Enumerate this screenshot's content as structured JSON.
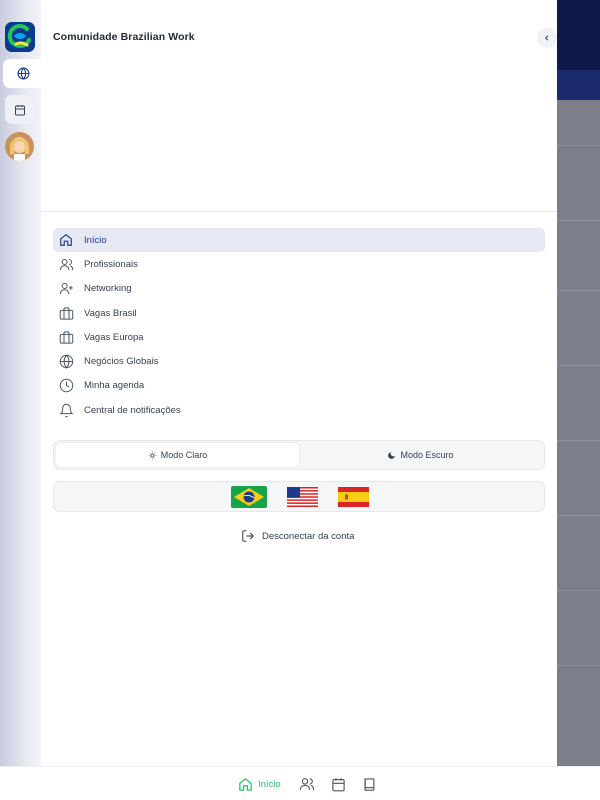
{
  "app": {
    "title": "Comunidade Brazilian Work"
  },
  "rail": {
    "items": [
      {
        "icon": "globe-icon",
        "active": true
      },
      {
        "icon": "calendar-icon",
        "active": false
      }
    ]
  },
  "nav": {
    "items": [
      {
        "label": "Início",
        "icon": "home-icon",
        "active": true
      },
      {
        "label": "Profissionais",
        "icon": "users-icon"
      },
      {
        "label": "Networking",
        "icon": "user-plus-icon"
      },
      {
        "label": "Vagas Brasil",
        "icon": "briefcase-icon"
      },
      {
        "label": "Vagas Europa",
        "icon": "briefcase-icon"
      },
      {
        "label": "Negócios Globais",
        "icon": "globe-icon"
      },
      {
        "label": "Minha agenda",
        "icon": "clock-icon"
      },
      {
        "label": "Central de notificações",
        "icon": "bell-icon"
      }
    ]
  },
  "theme": {
    "light_label": "Modo Claro",
    "dark_label": "Modo Escuro",
    "selected": "light"
  },
  "languages": [
    "flag-brazil-icon",
    "flag-usa-icon",
    "flag-spain-icon"
  ],
  "logout": {
    "label": "Desconectar da conta"
  },
  "bottom_nav": {
    "home_label": "Início"
  },
  "colors": {
    "accent": "#1e3a8a",
    "active_bg": "#e6e9f3",
    "bottom_active": "#22c55e"
  }
}
